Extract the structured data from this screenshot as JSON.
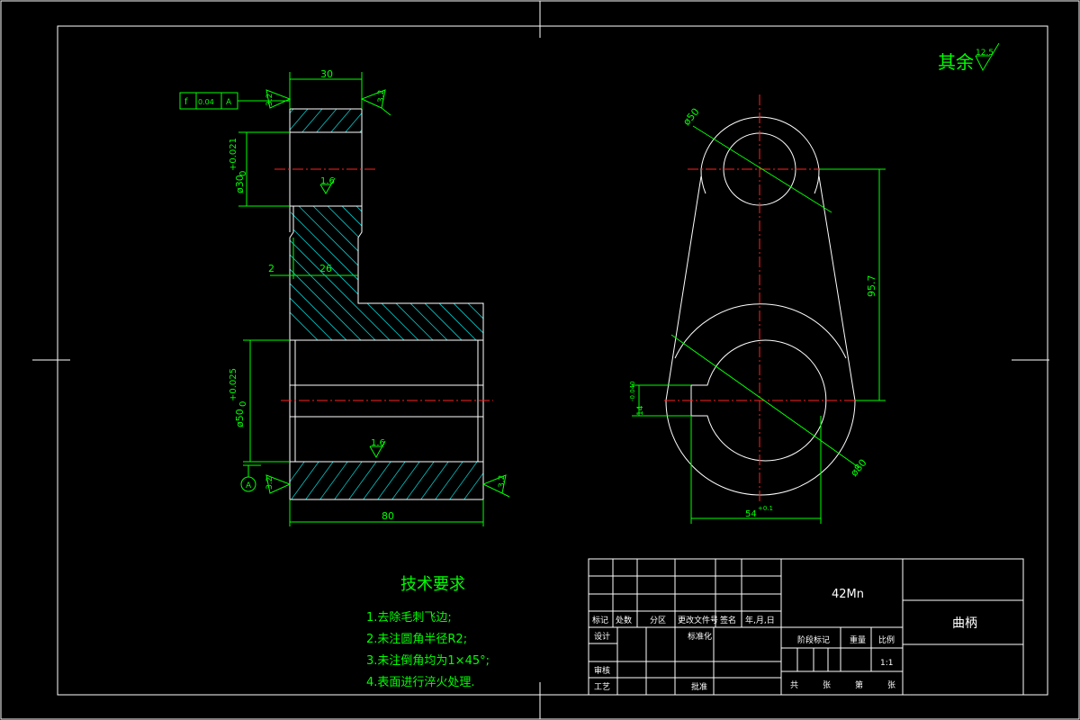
{
  "remaining_roughness": {
    "label": "其余",
    "value": "12.5"
  },
  "left_view": {
    "dim_top_width": "30",
    "dim_bottom_width": "80",
    "dim_shoulder": "26",
    "dim_offset": "2",
    "dim_small_bore": "ø30",
    "dim_small_bore_tol": "+0.021",
    "dim_small_bore_tol_low": "0",
    "dim_large_bore": "ø50",
    "dim_large_bore_tol": "+0.025",
    "dim_large_bore_tol_low": "0",
    "roughness_inner_1": "1.6",
    "roughness_inner_2": "1.6",
    "roughness_face_tl": "3.2",
    "roughness_face_tr": "3.2",
    "roughness_face_bl": "3.2",
    "roughness_face_br": "3.2",
    "tolerance_frame": {
      "symbol": "f",
      "value": "0.04",
      "datum": "A"
    },
    "datum_label": "A"
  },
  "right_view": {
    "dim_small_circle": "ø50",
    "dim_large_circle": "ø80",
    "dim_center_distance": "95.7",
    "dim_key_width": "14",
    "dim_key_tol": "-0.040",
    "dim_hub": "54",
    "dim_hub_tol": "+0.1"
  },
  "technical_requirements": {
    "title": "技术要求",
    "items": [
      "1.去除毛刺飞边;",
      "2.未注圆角半径R2;",
      "3.未注倒角均为1×45°;",
      "4.表面进行淬火处理."
    ]
  },
  "title_block": {
    "material": "42Mn",
    "part_name": "曲柄",
    "row_labels": [
      "标记",
      "处数",
      "分区",
      "更改文件号",
      "签名",
      "年,月,日"
    ],
    "design": "设计",
    "standardize": "标准化",
    "review": "审核",
    "process": "工艺",
    "approve": "批准",
    "stage_mark": "阶段标记",
    "weight": "重量",
    "scale_label": "比例",
    "scale": "1:1",
    "sheets_total": "共",
    "sheets_unit": "张",
    "sheet_no": "第",
    "sheet_unit2": "张"
  }
}
